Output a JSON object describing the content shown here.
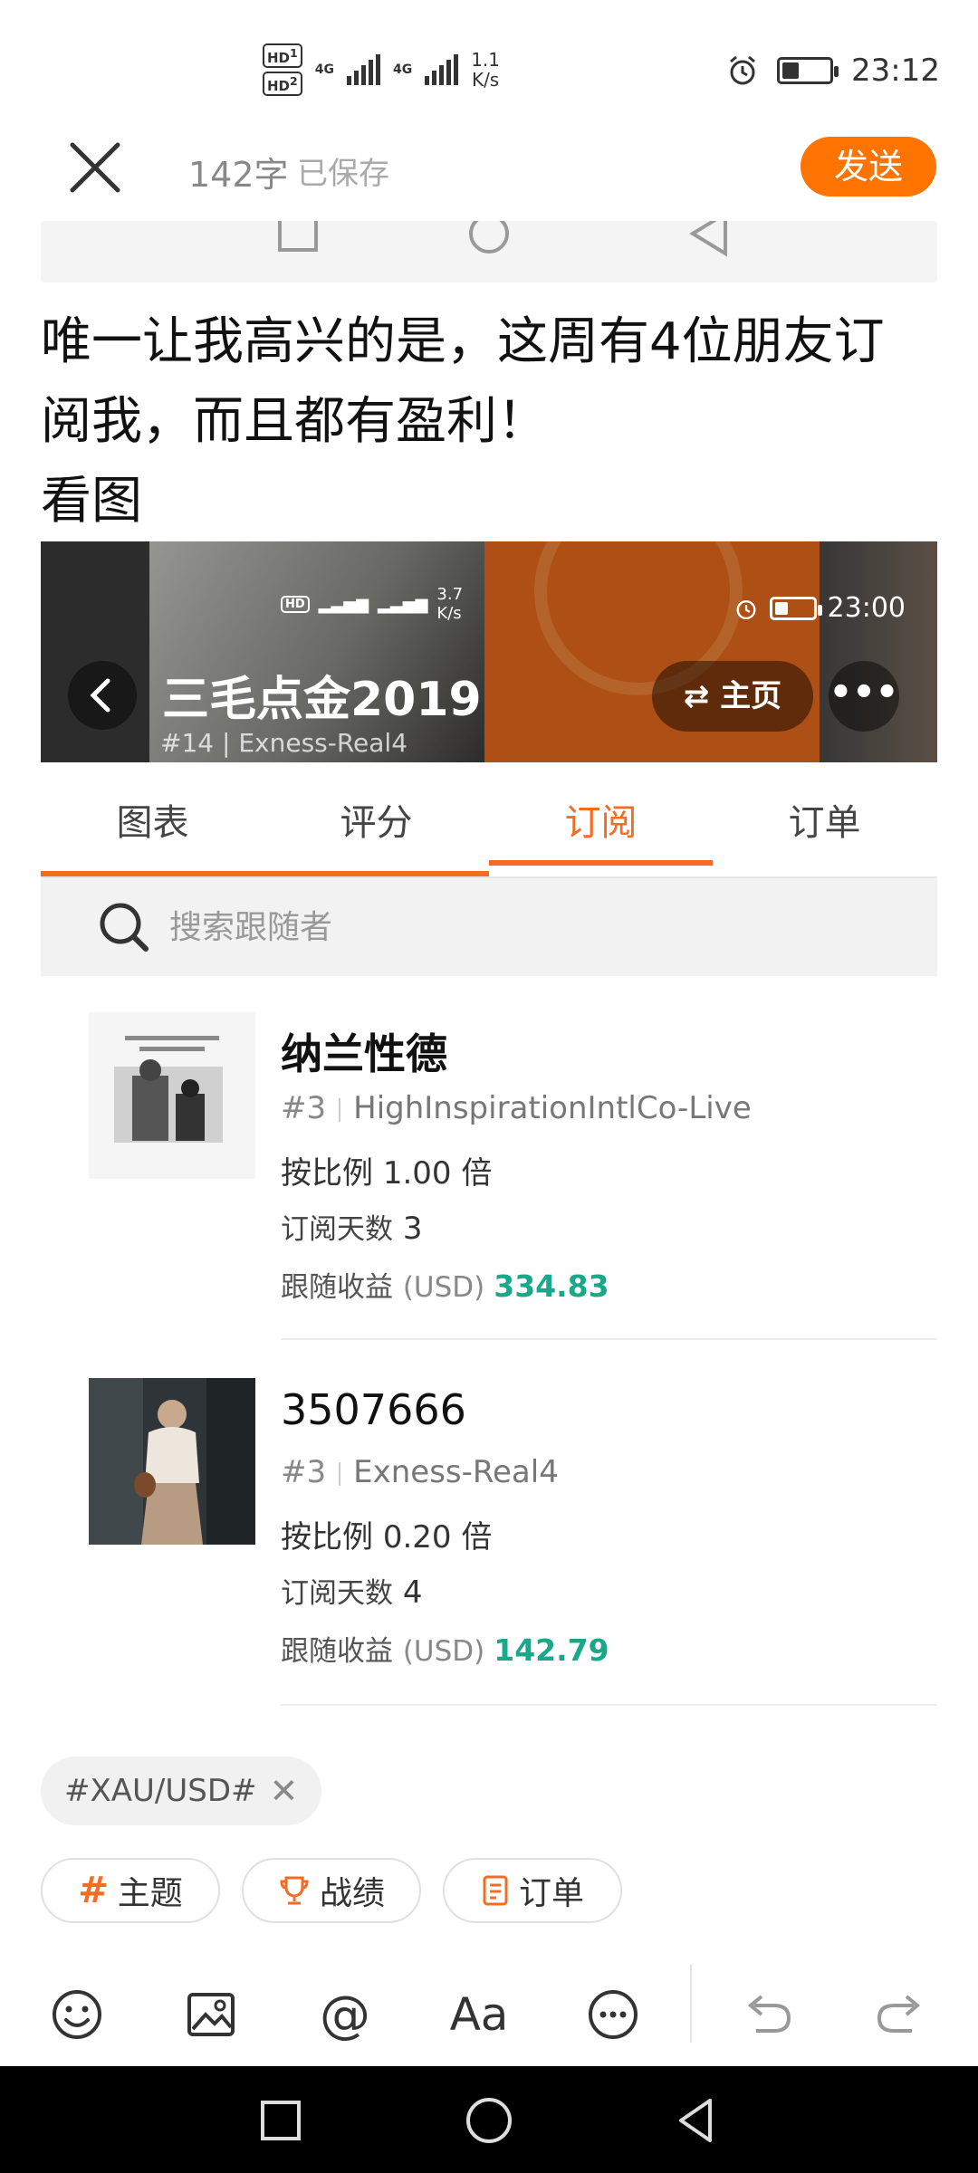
{
  "status_bar": {
    "hd1": "HD",
    "hd2": "HD",
    "sim1": "1",
    "sim2": "2",
    "net1": "4G",
    "net2": "4G",
    "speed_value": "1.1",
    "speed_unit": "K/s",
    "time": "23:12"
  },
  "header": {
    "char_count": "142字",
    "saved_label": "已保存",
    "send_label": "发送"
  },
  "post": {
    "line1": "唯一让我高兴的是，这周有4位朋友订",
    "line2": "阅我，而且都有盈利！",
    "line3": "看图"
  },
  "embedded_screenshot": {
    "status_speed_value": "3.7",
    "status_speed_unit": "K/s",
    "status_time": "23:00",
    "title": "三毛点金2019",
    "rank": "#14",
    "account": "Exness-Real4",
    "home_label": "主页"
  },
  "tabs": {
    "items": [
      "图表",
      "评分",
      "订阅",
      "订单"
    ],
    "active": "订阅"
  },
  "search": {
    "placeholder": "搜索跟随者"
  },
  "followers": [
    {
      "name": "纳兰性德",
      "rank": "#3",
      "account": "HighInspirationIntlCo-Live",
      "ratio_label": "按比例",
      "ratio_value": "1.00 倍",
      "days_label": "订阅天数",
      "days_value": "3",
      "profit_label": "跟随收益",
      "profit_unit": "(USD)",
      "profit_value": "334.83"
    },
    {
      "name": "3507666",
      "rank": "#3",
      "account": "Exness-Real4",
      "ratio_label": "按比例",
      "ratio_value": "0.20 倍",
      "days_label": "订阅天数",
      "days_value": "4",
      "profit_label": "跟随收益",
      "profit_unit": "(USD)",
      "profit_value": "142.79"
    }
  ],
  "topic_tag": "#XAU/USD#",
  "chips": {
    "topic": "主题",
    "record": "战绩",
    "order": "订单"
  },
  "toolbar": {
    "font_label": "Aa"
  },
  "colors": {
    "accent": "#f36c21",
    "send": "#ff7300",
    "profit": "#1aa88a"
  }
}
